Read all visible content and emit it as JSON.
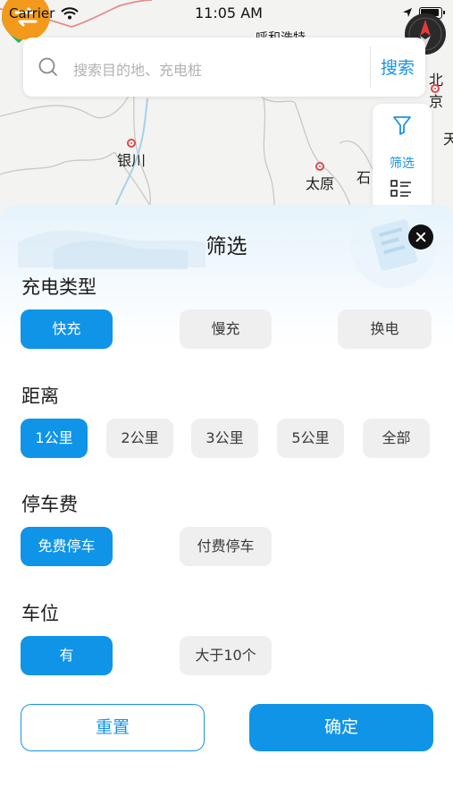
{
  "status_bar": {
    "carrier": "Carrier",
    "time": "11:05 AM"
  },
  "search": {
    "placeholder": "搜索目的地、充电桩",
    "button_label": "搜索"
  },
  "map": {
    "cities": [
      "银川",
      "太原",
      "北京",
      "石",
      "天"
    ],
    "partial_label": "呼和浩特",
    "marker_charge_color": "#27b462",
    "marker_swap_color": "#f39a1c"
  },
  "toolbar": {
    "filter_label": "筛选"
  },
  "filter_sheet": {
    "title": "筛选",
    "sections": [
      {
        "title": "充电类型",
        "options": [
          "快充",
          "慢充",
          "换电"
        ],
        "selected": "快充"
      },
      {
        "title": "距离",
        "options": [
          "1公里",
          "2公里",
          "3公里",
          "5公里",
          "全部"
        ],
        "selected": "1公里"
      },
      {
        "title": "停车费",
        "options": [
          "免费停车",
          "付费停车"
        ],
        "selected": "免费停车"
      },
      {
        "title": "车位",
        "options": [
          "有",
          "大于10个"
        ],
        "selected": "有"
      }
    ],
    "reset_label": "重置",
    "confirm_label": "确定"
  },
  "colors": {
    "accent": "#0f94e8",
    "chip_bg": "#efefef",
    "text": "#1c1c1c"
  }
}
